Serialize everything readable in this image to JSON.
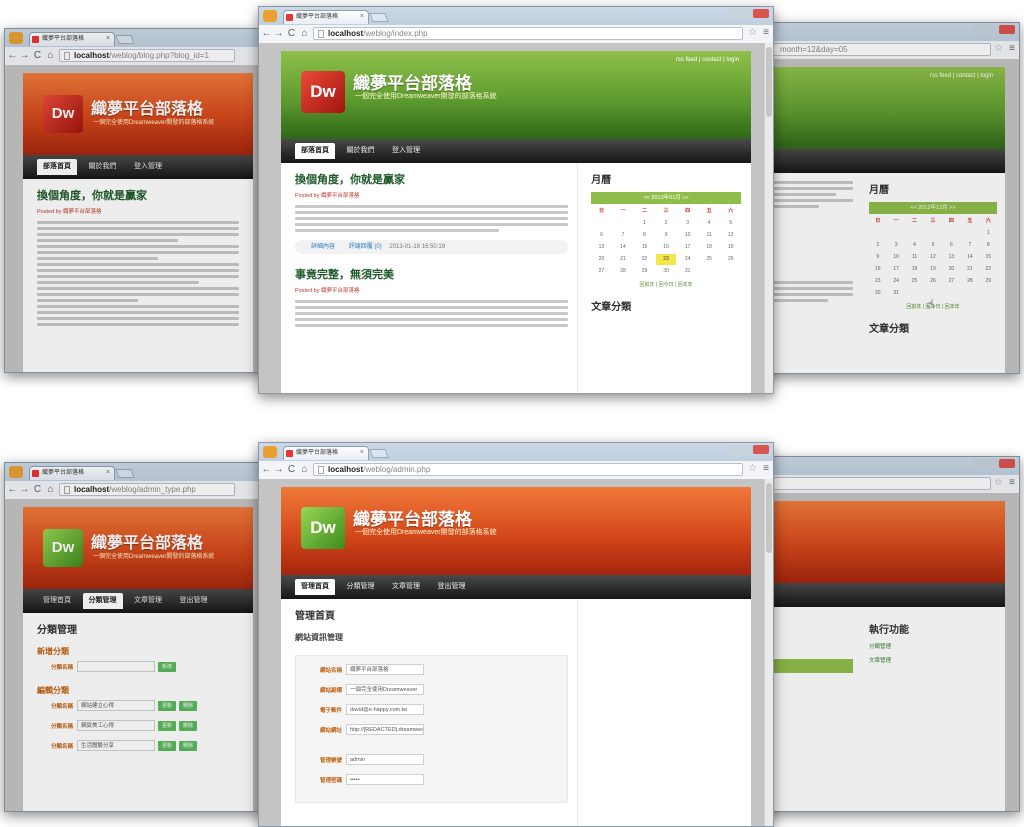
{
  "tab_title": "織夢平台部落格",
  "site": {
    "name": "織夢平台部落格",
    "subtitle": "一個完全使用Dreamweaver開發的部落格系統"
  },
  "browser": {
    "host": "localhost",
    "nav_back": "←",
    "nav_forward": "→",
    "nav_reload": "C",
    "nav_home": "⌂",
    "star": "☆",
    "menu": "≡"
  },
  "windows": {
    "w1": {
      "path": "/weblog/blog.php?blog_id=1"
    },
    "w2": {
      "path": "/weblog/index.php"
    },
    "w3": {
      "path": "month=12&day=05"
    },
    "w4": {
      "path": "/weblog/admin_type.php"
    },
    "w5": {
      "path": "/weblog/admin.php"
    },
    "w6": {
      "path": ""
    }
  },
  "toplinks": "rss feed | contact | login",
  "blog_menu": [
    "部落首頁",
    "關於我們",
    "登入管理"
  ],
  "admin_menu": [
    "管理首頁",
    "分類管理",
    "文章管理",
    "登出管理"
  ],
  "posts": [
    {
      "title": "換個角度，你就是贏家",
      "posted": "Posted by 織夢平台部落格",
      "date": "2013-01-18 16:50:19",
      "read_more": "詳細內容",
      "comments": "評論回覆 (0)"
    },
    {
      "title": "事竟完整，無須完美",
      "posted": "Posted by 織夢平台部落格"
    }
  ],
  "sidebar": {
    "calendar_title": "月曆",
    "calendar_caption": "<< 2013年01月 >>",
    "weekdays": [
      "日",
      "一",
      "二",
      "三",
      "四",
      "五",
      "六"
    ],
    "days": [
      "",
      "",
      "1",
      "2",
      "3",
      "4",
      "5",
      "6",
      "7",
      "8",
      "9",
      "10",
      "11",
      "12",
      "13",
      "14",
      "15",
      "16",
      "17",
      "18",
      "19",
      "20",
      "21",
      "22",
      "23",
      "24",
      "25",
      "26",
      "27",
      "28",
      "29",
      "30",
      "31",
      "",
      ""
    ],
    "today": "23",
    "calendar_foot": "回前年 | 回今日 | 回本年",
    "category_title": "文章分類",
    "side_calendar_caption": "<< 2012年12月 >>",
    "side_days": [
      "",
      "",
      "",
      "",
      "",
      "",
      "1",
      "2",
      "3",
      "4",
      "5",
      "6",
      "7",
      "8",
      "9",
      "10",
      "11",
      "12",
      "13",
      "14",
      "15",
      "16",
      "17",
      "18",
      "19",
      "20",
      "21",
      "22",
      "23",
      "24",
      "25",
      "26",
      "27",
      "28",
      "29",
      "30",
      "31"
    ]
  },
  "type_admin": {
    "title": "分類管理",
    "add_title": "新增分類",
    "add_label": "分類名稱",
    "add_button": "新增",
    "edit_title": "編輯分類",
    "edit_label": "分類名稱",
    "rows": [
      "網站建立心得",
      "網頁美工心得",
      "生活體驗分享"
    ],
    "update_button": "更新",
    "delete_button": "刪除"
  },
  "admin_home": {
    "title": "管理首頁",
    "sub": "網站資訊管理",
    "fields": [
      {
        "label": "網站名稱",
        "value": "織夢平台部落格"
      },
      {
        "label": "網站副標",
        "value": "一個完全使用Dreamweaver"
      },
      {
        "label": "電子郵件",
        "value": "david@e-happy.com.tw"
      },
      {
        "label": "網站網址",
        "value": "http://[REDACTED].dreamweaver.c"
      },
      {
        "label": "管理帳號",
        "value": "admin"
      },
      {
        "label": "管理密碼",
        "value": "•••••"
      }
    ],
    "action_title": "執行功能",
    "action_links": [
      "分類管理",
      "文章管理"
    ]
  }
}
